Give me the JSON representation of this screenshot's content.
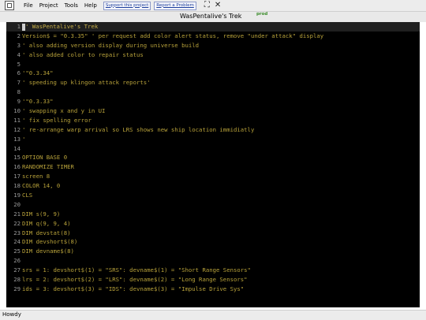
{
  "menu": {
    "items": [
      "File",
      "Project",
      "Tools",
      "Help"
    ]
  },
  "links": {
    "support": "Support this project",
    "report": "Report a Problem"
  },
  "window": {
    "title": "WasPentalive's Trek",
    "badge": "prod"
  },
  "editor": {
    "current_line": 1,
    "lines": [
      "' WasPentalive's Trek",
      "Version$ = \"0.3.35\" ' per request add color alert status, remove \"under attack\" display",
      "' also adding version display during universe build",
      "' also added color to repair status",
      "",
      "'\"0.3.34\"",
      "' speeding up klingon attack reports'",
      "",
      "'\"0.3.33\"",
      "' swapping x and y in UI",
      "' fix spelling error",
      "' re-arrange warp arrival so LRS shows new ship location immidiatly",
      "'",
      "",
      "OPTION BASE 0",
      "RANDOMIZE TIMER",
      "screen 8",
      "COLOR 14, 0",
      "CLS",
      "",
      "DIM s(9, 9)",
      "DIM q(9, 9, 4)",
      "DIM devstat(8)",
      "DIM devshort$(8)",
      "DIM devname$(8)",
      "",
      "srs = 1: devshort$(1) = \"SRS\": devname$(1) = \"Short Range Sensors\"",
      "lrs = 2: devshort$(2) = \"LRS\": devname$(2) = \"Long Range Sensors\"",
      "ids = 3: devshort$(3) = \"IDS\": devname$(3) = \"Impulse Drive Sys\""
    ]
  },
  "status": {
    "text": "Howdy"
  }
}
